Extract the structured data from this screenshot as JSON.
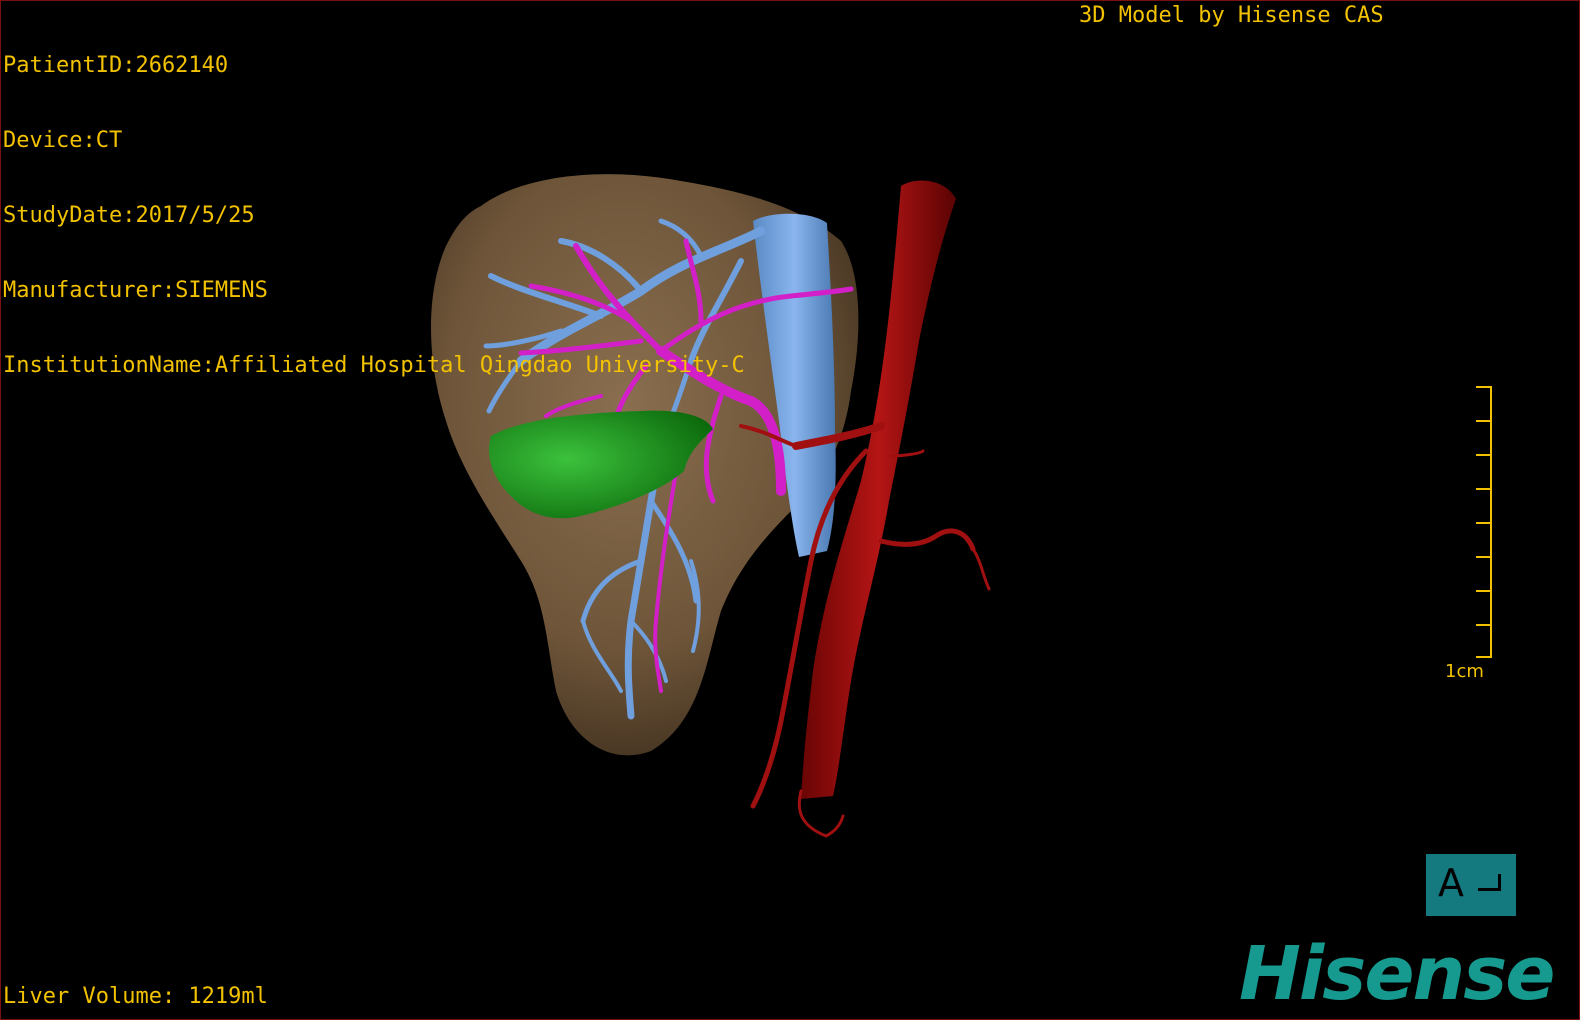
{
  "overlay": {
    "patient_id": "PatientID:2662140",
    "device": "Device:CT",
    "study_date": "StudyDate:2017/5/25",
    "manufacturer": "Manufacturer:SIEMENS",
    "institution": "InstitutionName:Affiliated Hospital Qingdao University-C",
    "model_credit": "3D Model by Hisense CAS",
    "liver_volume": "Liver Volume: 1219ml"
  },
  "scale_bar": {
    "label": "1cm"
  },
  "orientation_cube": {
    "letter": "A"
  },
  "logo": {
    "text": "Hisense"
  },
  "colors": {
    "overlay_text": "#f2c200",
    "liver": "#7d6347",
    "portal_vein": "#6f9fdd",
    "hepatic_vein": "#d21fc8",
    "gallbladder": "#1a9e1a",
    "aorta": "#a01010",
    "logo": "#16998e",
    "orientation_bg": "#157a80"
  },
  "structures": [
    "liver",
    "portal-vein",
    "hepatic-veins",
    "inferior-vena-cava",
    "gallbladder",
    "aorta"
  ]
}
